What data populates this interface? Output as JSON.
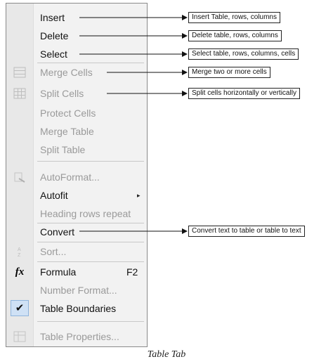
{
  "menu": {
    "items": [
      {
        "label": "Insert",
        "enabled": true,
        "icon": null
      },
      {
        "label": "Delete",
        "enabled": true,
        "icon": null
      },
      {
        "label": "Select",
        "enabled": true,
        "icon": null
      },
      {
        "label": "Merge Cells",
        "enabled": false,
        "icon": "merge-cells-icon"
      },
      {
        "label": "Split Cells",
        "enabled": false,
        "icon": "split-cells-icon"
      },
      {
        "label": "Protect Cells",
        "enabled": false,
        "icon": null
      },
      {
        "label": "Merge Table",
        "enabled": false,
        "icon": null
      },
      {
        "label": "Split Table",
        "enabled": false,
        "icon": null
      },
      {
        "label": "AutoFormat...",
        "enabled": false,
        "icon": "autoformat-icon"
      },
      {
        "label": "Autofit",
        "enabled": true,
        "icon": null,
        "submenu": "▸"
      },
      {
        "label": "Heading rows repeat",
        "enabled": false,
        "icon": null
      },
      {
        "label": "Convert",
        "enabled": true,
        "icon": null
      },
      {
        "label": "Sort...",
        "enabled": false,
        "icon": "sort-icon"
      },
      {
        "label": "Formula",
        "enabled": true,
        "icon": "fx-icon",
        "shortcut": "F2"
      },
      {
        "label": "Number Format...",
        "enabled": false,
        "icon": null
      },
      {
        "label": "Table Boundaries",
        "enabled": true,
        "icon": "checkmark-icon",
        "checked": true
      },
      {
        "label": "Table Properties...",
        "enabled": false,
        "icon": "table-properties-icon"
      }
    ]
  },
  "callouts": [
    {
      "text": "Insert Table, rows, columns",
      "item": 0
    },
    {
      "text": "Delete table, rows, columns",
      "item": 1
    },
    {
      "text": "Select table, rows, columns, cells",
      "item": 2
    },
    {
      "text": "Merge two or more cells",
      "item": 3
    },
    {
      "text": "Split cells horizontally or vertically",
      "item": 4
    },
    {
      "text": "Convert text to table or table to text",
      "item": 11
    }
  ],
  "caption": "Table Tab",
  "colors": {
    "enabled_text": "#111111",
    "disabled_text": "#9a9a9a",
    "menu_bg": "#f2f2f2",
    "check_bg": "#cfe1f5"
  }
}
